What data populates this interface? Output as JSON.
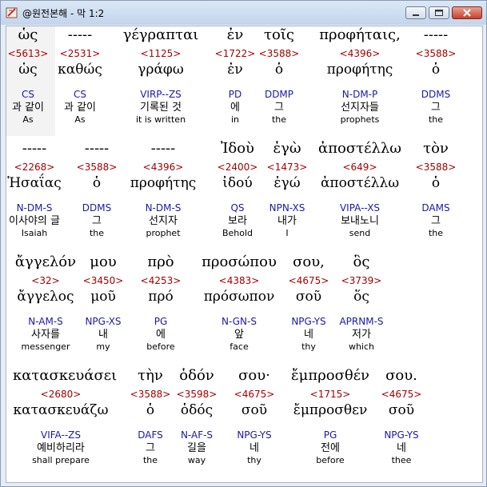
{
  "window": {
    "title": "@원전본해 - 막 1:2"
  },
  "icons": {
    "app": "bible-app-icon",
    "minimize": "minimize-icon",
    "maximize": "maximize-icon",
    "close": "close-icon"
  },
  "colors": {
    "strong": "#a40000",
    "parse": "#1a1aa8",
    "text": "#000000"
  },
  "rows": [
    {
      "words": [
        {
          "greek": "ὡς",
          "strong": "<5613>",
          "lemma": "ὡς",
          "parse": "CS",
          "korean": "과 같이",
          "english": "As"
        },
        {
          "greek": "-----",
          "strong": "<2531>",
          "lemma": "καθώς",
          "parse": "CS",
          "korean": "과 같이",
          "english": "As"
        },
        {
          "greek": "γέγραπται",
          "strong": "<1125>",
          "lemma": "γράφω",
          "parse": "VIRP--ZS",
          "korean": "기록된 것",
          "english": "it is written"
        },
        {
          "greek": "ἐν",
          "strong": "<1722>",
          "lemma": "ἐν",
          "parse": "PD",
          "korean": "에",
          "english": "in"
        },
        {
          "greek": "τοῖς",
          "strong": "<3588>",
          "lemma": "ὁ",
          "parse": "DDMP",
          "korean": "그",
          "english": "the"
        },
        {
          "greek": "προφήταις,",
          "strong": "<4396>",
          "lemma": "προφήτης",
          "parse": "N-DM-P",
          "korean": "선지자들",
          "english": "prophets"
        },
        {
          "greek": "-----",
          "strong": "<3588>",
          "lemma": "ὁ",
          "parse": "DDMS",
          "korean": "그",
          "english": "the"
        }
      ]
    },
    {
      "words": [
        {
          "greek": "-----",
          "strong": "<2268>",
          "lemma": "Ἡσαΐας",
          "parse": "N-DM-S",
          "korean": "이사야의 글",
          "english": "Isaiah"
        },
        {
          "greek": "-----",
          "strong": "<3588>",
          "lemma": "ὁ",
          "parse": "DDMS",
          "korean": "그",
          "english": "the"
        },
        {
          "greek": "-----",
          "strong": "<4396>",
          "lemma": "προφήτης",
          "parse": "N-DM-S",
          "korean": "선지자",
          "english": "prophet"
        },
        {
          "greek": "Ἰδοὺ",
          "strong": "<2400>",
          "lemma": "ἰδού",
          "parse": "QS",
          "korean": "보라",
          "english": "Behold"
        },
        {
          "greek": "ἐγὼ",
          "strong": "<1473>",
          "lemma": "ἐγώ",
          "parse": "NPN-XS",
          "korean": "내가",
          "english": "I"
        },
        {
          "greek": "ἀποστέλλω",
          "strong": "<649>",
          "lemma": "ἀποστέλλω",
          "parse": "VIPA--XS",
          "korean": "보내노니",
          "english": "send"
        },
        {
          "greek": "τὸν",
          "strong": "<3588>",
          "lemma": "ὁ",
          "parse": "DAMS",
          "korean": "그",
          "english": "the"
        }
      ]
    },
    {
      "words": [
        {
          "greek": "ἄγγελόν",
          "strong": "<32>",
          "lemma": "ἄγγελος",
          "parse": "N-AM-S",
          "korean": "사자를",
          "english": "messenger"
        },
        {
          "greek": "μου",
          "strong": "<3450>",
          "lemma": "μοῦ",
          "parse": "NPG-XS",
          "korean": "내",
          "english": "my"
        },
        {
          "greek": "πρὸ",
          "strong": "<4253>",
          "lemma": "πρό",
          "parse": "PG",
          "korean": "에",
          "english": "before"
        },
        {
          "greek": "προσώπου",
          "strong": "<4383>",
          "lemma": "πρόσωπον",
          "parse": "N-GN-S",
          "korean": "앞",
          "english": "face"
        },
        {
          "greek": "σου,",
          "strong": "<4675>",
          "lemma": "σοῦ",
          "parse": "NPG-YS",
          "korean": "네",
          "english": "thy"
        },
        {
          "greek": "ὃς",
          "strong": "<3739>",
          "lemma": "ὅς",
          "parse": "APRNM-S",
          "korean": "저가",
          "english": "which"
        }
      ]
    },
    {
      "words": [
        {
          "greek": "κατασκευάσει",
          "strong": "<2680>",
          "lemma": "κατασκευάζω",
          "parse": "VIFA--ZS",
          "korean": "예비하리라",
          "english": "shall prepare"
        },
        {
          "greek": "τὴν",
          "strong": "<3588>",
          "lemma": "ὁ",
          "parse": "DAFS",
          "korean": "그",
          "english": "the"
        },
        {
          "greek": "ὁδόν",
          "strong": "<3598>",
          "lemma": "ὁδός",
          "parse": "N-AF-S",
          "korean": "길을",
          "english": "way"
        },
        {
          "greek": "σου·",
          "strong": "<4675>",
          "lemma": "σοῦ",
          "parse": "NPG-YS",
          "korean": "네",
          "english": "thy"
        },
        {
          "greek": "ἔμπροσθέν",
          "strong": "<1715>",
          "lemma": "ἔμπροσθεν",
          "parse": "PG",
          "korean": "전에",
          "english": "before"
        },
        {
          "greek": "σου.",
          "strong": "<4675>",
          "lemma": "σοῦ",
          "parse": "NPG-YS",
          "korean": "네",
          "english": "thee"
        }
      ]
    }
  ]
}
